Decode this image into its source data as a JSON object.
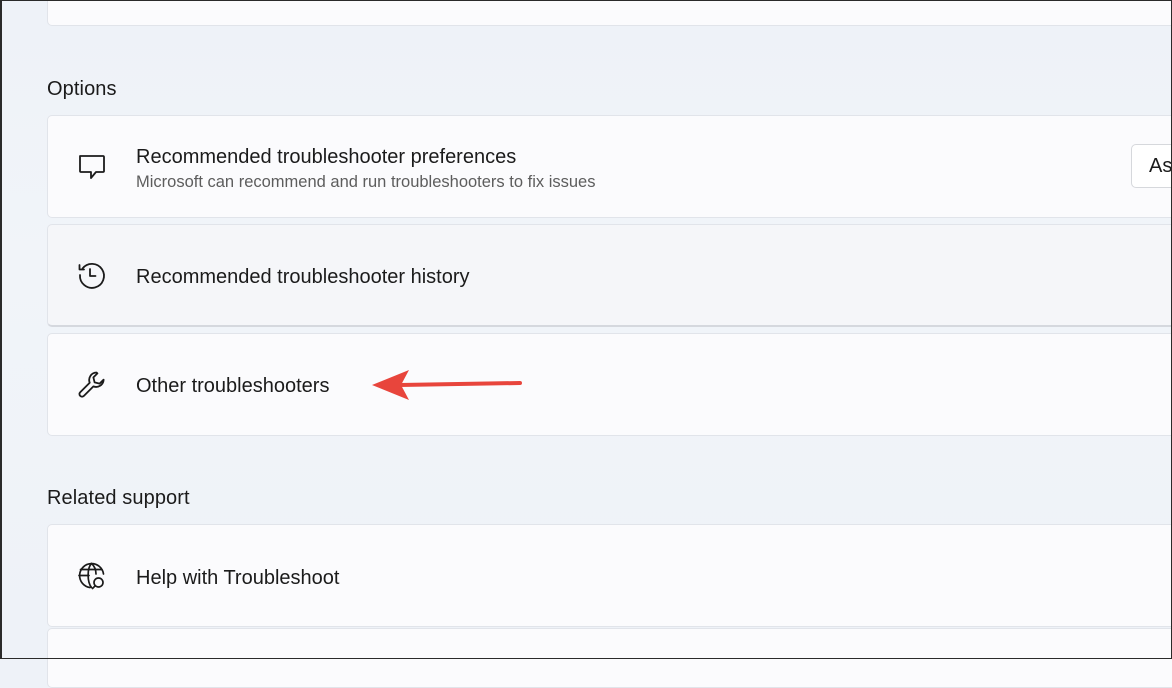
{
  "options": {
    "title": "Options",
    "items": [
      {
        "icon": "chat-bubble-icon",
        "label": "Recommended troubleshooter preferences",
        "description": "Microsoft can recommend and run troubleshooters to fix issues",
        "dropdown_value": "As"
      },
      {
        "icon": "history-icon",
        "label": "Recommended troubleshooter history"
      },
      {
        "icon": "wrench-icon",
        "label": "Other troubleshooters"
      }
    ]
  },
  "related_support": {
    "title": "Related support",
    "items": [
      {
        "icon": "globe-search-icon",
        "label": "Help with Troubleshoot"
      }
    ]
  },
  "annotation": {
    "arrow_color": "#e8453c"
  }
}
